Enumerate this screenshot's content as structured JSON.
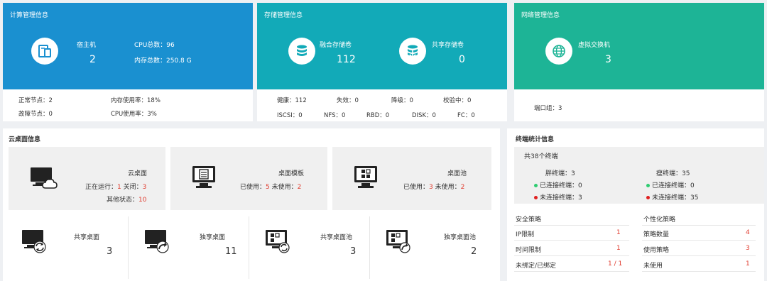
{
  "compute": {
    "title": "计算管理信息",
    "host_label": "宿主机",
    "host_count": "2",
    "cpu_total": "CPU总数：96",
    "mem_total": "内存总数：250.8 G",
    "normal_nodes": "正常节点：2",
    "fault_nodes": "故障节点：0",
    "mem_usage": "内存使用率：18%",
    "cpu_usage": "CPU使用率：3%",
    "color": "#1a90d0"
  },
  "storage": {
    "title": "存储管理信息",
    "fusion_label": "融合存储卷",
    "fusion_count": "112",
    "shared_label": "共享存储卷",
    "shared_count": "0",
    "healthy": "健康：112",
    "failed": "失效：0",
    "degraded": "降级：0",
    "verifying": "校验中：0",
    "iscsi": "ISCSI：0",
    "nfs": "NFS：0",
    "rbd": "RBD：0",
    "disk": "DISK：0",
    "fc": "FC：0",
    "color": "#12aab8"
  },
  "network": {
    "title": "网络管理信息",
    "vswitch_label": "虚拟交换机",
    "vswitch_count": "3",
    "port_group": "端口组：3",
    "color": "#1db496"
  },
  "desktop": {
    "title": "云桌面信息",
    "cloud": {
      "label": "云桌面",
      "running_label": "正在运行：",
      "running": "1",
      "closed_label": "关闭：",
      "closed": "3",
      "other_label": "其他状态：",
      "other": "10"
    },
    "template": {
      "label": "桌面模板",
      "used_label": "已使用：",
      "used": "5",
      "unused_label": "未使用：",
      "unused": "2"
    },
    "pool": {
      "label": "桌面池",
      "used_label": "已使用：",
      "used": "3",
      "unused_label": "未使用：",
      "unused": "2"
    },
    "bottom": [
      {
        "label": "共享桌面",
        "count": "3"
      },
      {
        "label": "独享桌面",
        "count": "11"
      },
      {
        "label": "共享桌面池",
        "count": "3"
      },
      {
        "label": "独享桌面池",
        "count": "2"
      }
    ]
  },
  "terminal": {
    "title": "终端统计信息",
    "total": "共38个终端",
    "fat": "胖终端：3",
    "fat_connected": "已连接终端：0",
    "fat_disconnected": "未连接终端：3",
    "thin": "瘦终端：35",
    "thin_connected": "已连接终端：0",
    "thin_disconnected": "未连接终端：35",
    "connected_color": "#2ecc71",
    "disconnected_color": "#e02020",
    "security": {
      "title": "安全策略",
      "rows": [
        {
          "label": "IP限制",
          "value": "1"
        },
        {
          "label": "时间限制",
          "value": "1"
        },
        {
          "label": "未绑定/已绑定",
          "value": "1 / 1"
        }
      ]
    },
    "personal": {
      "title": "个性化策略",
      "rows": [
        {
          "label": "策略数量",
          "value": "4"
        },
        {
          "label": "使用策略",
          "value": "3"
        },
        {
          "label": "未使用",
          "value": "1"
        }
      ]
    }
  }
}
